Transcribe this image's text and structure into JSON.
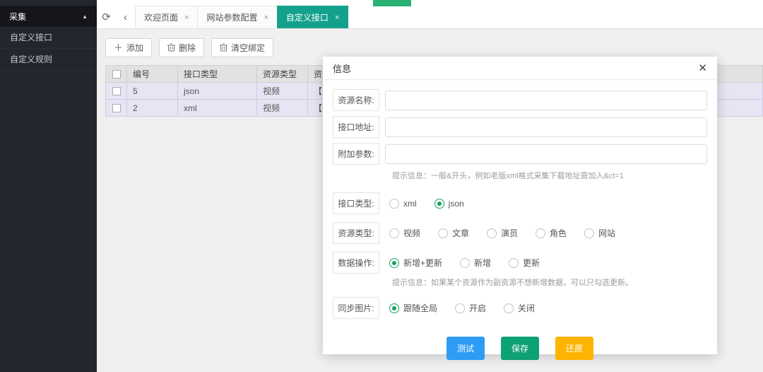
{
  "colors": {
    "sidebar_bg": "#23262d",
    "active_tab_teal": "#14a18c",
    "radio_green": "#17a35f",
    "btn_blue": "#2d9cf5",
    "btn_green": "#0da173",
    "btn_yellow": "#fdb400",
    "row_highlight": "#e7e4f3"
  },
  "sidebar": {
    "header_label": "采集",
    "collapse_icon": "▲",
    "items": [
      {
        "label": "自定义接口"
      },
      {
        "label": "自定义规则"
      }
    ]
  },
  "tabbar": {
    "refresh_icon": "⟳",
    "back_icon": "‹",
    "tabs": [
      {
        "label": "欢迎页面",
        "close": "×",
        "active": false
      },
      {
        "label": "网站参数配置",
        "close": "×",
        "active": false
      },
      {
        "label": "自定义接口",
        "close": "×",
        "active": true
      }
    ]
  },
  "toolbar": {
    "add_icon": "＋",
    "add_label": "添加",
    "delete_label": "删除",
    "clear_label": "清空绑定"
  },
  "table": {
    "headers": {
      "id": "编号",
      "api_type": "接口类型",
      "res_type": "资源类型",
      "res_name": "资源名"
    },
    "rows": [
      {
        "id": "5",
        "api_type": "json",
        "res_type": "视频",
        "res_name": "【哥"
      },
      {
        "id": "2",
        "api_type": "xml",
        "res_type": "视频",
        "res_name": "【海"
      }
    ]
  },
  "modal": {
    "title": "信息",
    "close_icon": "✕",
    "labels": {
      "res_name": "资源名称:",
      "api_url": "接口地址:",
      "extra_param": "附加参数:",
      "api_type": "接口类型:",
      "res_type": "资源类型:",
      "data_op": "数据操作:",
      "sync_img": "同步图片:"
    },
    "inputs": {
      "res_name_value": "",
      "api_url_value": "",
      "extra_param_value": ""
    },
    "hints": {
      "param_hint": "提示信息：一般&开头，例如老版xml格式采集下载地址需加入&ct=1",
      "data_op_hint": "提示信息：如果某个资源作为副资源不想新增数据，可以只勾选更新。"
    },
    "api_type_options": [
      {
        "label": "xml",
        "selected": false
      },
      {
        "label": "json",
        "selected": true
      }
    ],
    "res_type_options": [
      {
        "label": "视频",
        "selected": false
      },
      {
        "label": "文章",
        "selected": false
      },
      {
        "label": "演员",
        "selected": false
      },
      {
        "label": "角色",
        "selected": false
      },
      {
        "label": "网站",
        "selected": false
      }
    ],
    "data_op_options": [
      {
        "label": "新增+更新",
        "selected": true
      },
      {
        "label": "新增",
        "selected": false
      },
      {
        "label": "更新",
        "selected": false
      }
    ],
    "sync_img_options": [
      {
        "label": "跟随全局",
        "selected": true
      },
      {
        "label": "开启",
        "selected": false
      },
      {
        "label": "关闭",
        "selected": false
      }
    ],
    "buttons": {
      "test": "测试",
      "save": "保存",
      "reset": "还原"
    }
  }
}
